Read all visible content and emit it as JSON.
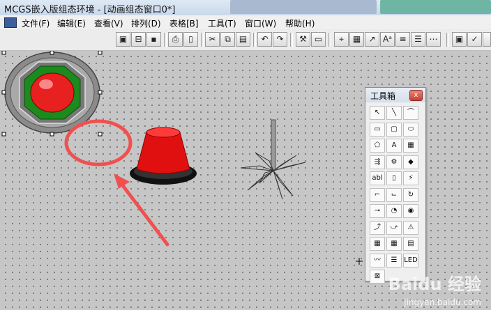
{
  "window": {
    "title": "MCGS嵌入版组态环境 - [动画组态窗口0*]"
  },
  "menu": [
    "文件(F)",
    "编辑(E)",
    "查看(V)",
    "排列(D)",
    "表格[B]",
    "工具(T)",
    "窗口(W)",
    "帮助(H)"
  ],
  "toolbar": {
    "icons": [
      "window-icon",
      "toggle-icon",
      "save-icon",
      "print-icon",
      "print-preview-icon",
      "cut-icon",
      "copy-icon",
      "paste-icon",
      "undo-icon",
      "redo-icon",
      "tools-icon",
      "property-icon",
      "object-icon",
      "bitmap-icon",
      "font-icon",
      "align-icon",
      "align-left-icon",
      "grid-icon",
      "checklist-icon",
      "check-icon",
      "more-icon"
    ]
  },
  "toolbox": {
    "title": "工具箱",
    "close": "x",
    "tools": [
      {
        "name": "pointer-tool",
        "glyph": "↖"
      },
      {
        "name": "line-tool",
        "glyph": "╲"
      },
      {
        "name": "arc-tool",
        "glyph": "⌒"
      },
      {
        "name": "rectangle-tool",
        "glyph": "▭"
      },
      {
        "name": "rounded-rect-tool",
        "glyph": "▢"
      },
      {
        "name": "ellipse-tool",
        "glyph": "⬭"
      },
      {
        "name": "polygon-tool",
        "glyph": "⬠"
      },
      {
        "name": "text-tool",
        "glyph": "A"
      },
      {
        "name": "bitmap-tool",
        "glyph": "▦"
      },
      {
        "name": "flowline-tool",
        "glyph": "⇶"
      },
      {
        "name": "connector-tool",
        "glyph": "⚙"
      },
      {
        "name": "element-tool",
        "glyph": "◆"
      },
      {
        "name": "label-tool",
        "glyph": "abl"
      },
      {
        "name": "slider-tool",
        "glyph": "▯"
      },
      {
        "name": "button-tool",
        "glyph": "⚡"
      },
      {
        "name": "step-line-tool",
        "glyph": "⌐"
      },
      {
        "name": "breakline-tool",
        "glyph": "⌙"
      },
      {
        "name": "rotate-tool",
        "glyph": "↻"
      },
      {
        "name": "input-tool",
        "glyph": "⊸"
      },
      {
        "name": "clock-tool",
        "glyph": "◔"
      },
      {
        "name": "indicator-tool",
        "glyph": "◉"
      },
      {
        "name": "curve-tool",
        "glyph": "⤴"
      },
      {
        "name": "history-curve-tool",
        "glyph": "⤻"
      },
      {
        "name": "alarm-tool",
        "glyph": "⚠"
      },
      {
        "name": "table-tool",
        "glyph": "▦"
      },
      {
        "name": "grid-table-tool",
        "glyph": "▦"
      },
      {
        "name": "report-tool",
        "glyph": "▤"
      },
      {
        "name": "trend-tool",
        "glyph": "〰"
      },
      {
        "name": "list-tool",
        "glyph": "☰"
      },
      {
        "name": "led-tool",
        "glyph": "LED"
      },
      {
        "name": "picture-tool",
        "glyph": "⊠"
      }
    ]
  },
  "watermark": {
    "brand": "Baidu 经验",
    "url": "jingyan.baidu.com"
  },
  "colors": {
    "red": "#e82020",
    "green": "#1c8a1c",
    "canvas": "#c6c6c6",
    "annotation": "#f05050"
  }
}
